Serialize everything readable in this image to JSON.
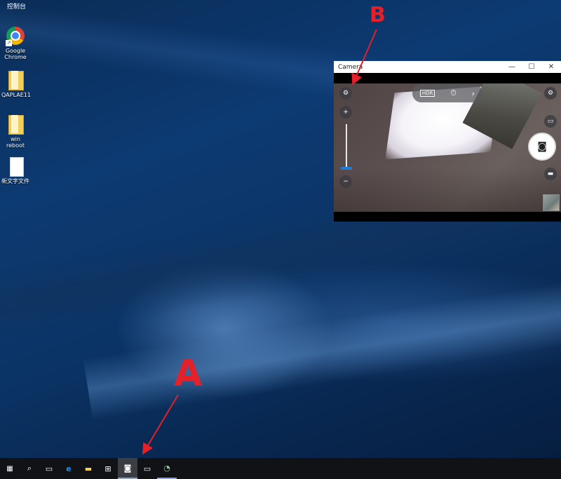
{
  "desktop": {
    "top_label": "控制台",
    "icons": [
      {
        "label_line1": "Google",
        "label_line2": "Chrome",
        "icon": "chrome-icon"
      },
      {
        "label_line1": "QAPLAE11",
        "label_line2": "",
        "icon": "folder-icon"
      },
      {
        "label_line1": "win reboot",
        "label_line2": "",
        "icon": "folder-icon"
      },
      {
        "label_line1": "新文字文件",
        "label_line2": "",
        "icon": "text-file-icon"
      }
    ]
  },
  "camera_window": {
    "title": "Camera",
    "controls": {
      "minimize": "—",
      "maximize": "☐",
      "close": "✕"
    },
    "topbar": {
      "hdr_label": "HDR",
      "timer": "⏱",
      "more": "›"
    },
    "zoom_in": "+",
    "zoom_out": "−",
    "zoom_level": 0.05
  },
  "taskbar": {
    "items": [
      "start",
      "search",
      "task-view",
      "edge",
      "file-explorer",
      "store",
      "camera",
      "window",
      "app"
    ]
  },
  "annotations": {
    "a": "A",
    "b": "B"
  },
  "colors": {
    "annotation": "#e2212a",
    "taskbar": "#101216",
    "accent": "#1e7bd6"
  }
}
